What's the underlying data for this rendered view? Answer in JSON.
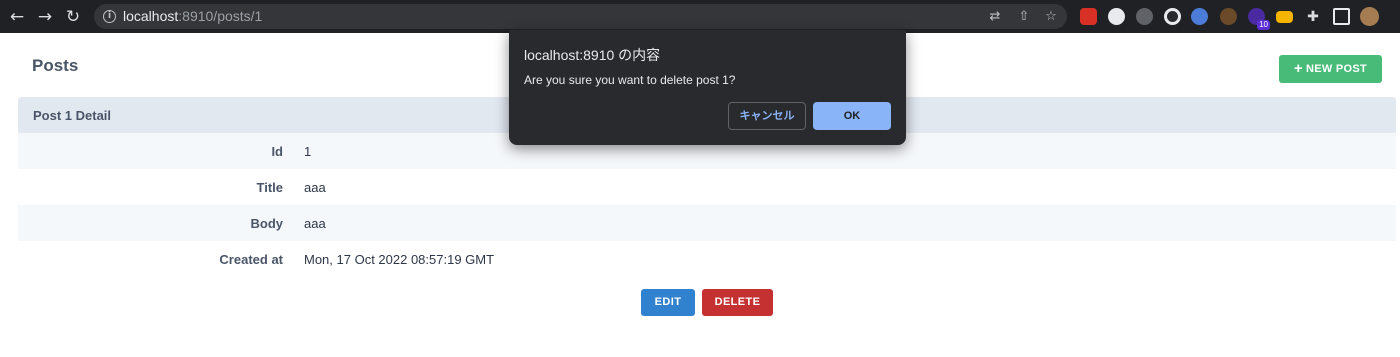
{
  "browser": {
    "url_host": "localhost",
    "url_path": ":8910/posts/1",
    "icons": {
      "back": "←",
      "forward": "→",
      "reload": "↻",
      "info": "i",
      "translate": "⇄",
      "share": "⇧",
      "bookmark": "☆",
      "puzzle": "✚"
    },
    "ext_badge": "10"
  },
  "page": {
    "title": "Posts",
    "new_post_label": "NEW POST",
    "new_post_plus": "+",
    "detail_title": "Post 1 Detail",
    "rows": [
      {
        "label": "Id",
        "value": "1"
      },
      {
        "label": "Title",
        "value": "aaa"
      },
      {
        "label": "Body",
        "value": "aaa"
      },
      {
        "label": "Created at",
        "value": "Mon, 17 Oct 2022 08:57:19 GMT"
      }
    ],
    "edit_label": "EDIT",
    "delete_label": "DELETE"
  },
  "dialog": {
    "title": "localhost:8910 の内容",
    "message": "Are you sure you want to delete post 1?",
    "cancel_label": "キャンセル",
    "ok_label": "OK"
  },
  "colors": {
    "new_post": "#48bb78",
    "edit": "#3182ce",
    "delete": "#c53030",
    "dialog_ok": "#8ab4f8"
  }
}
